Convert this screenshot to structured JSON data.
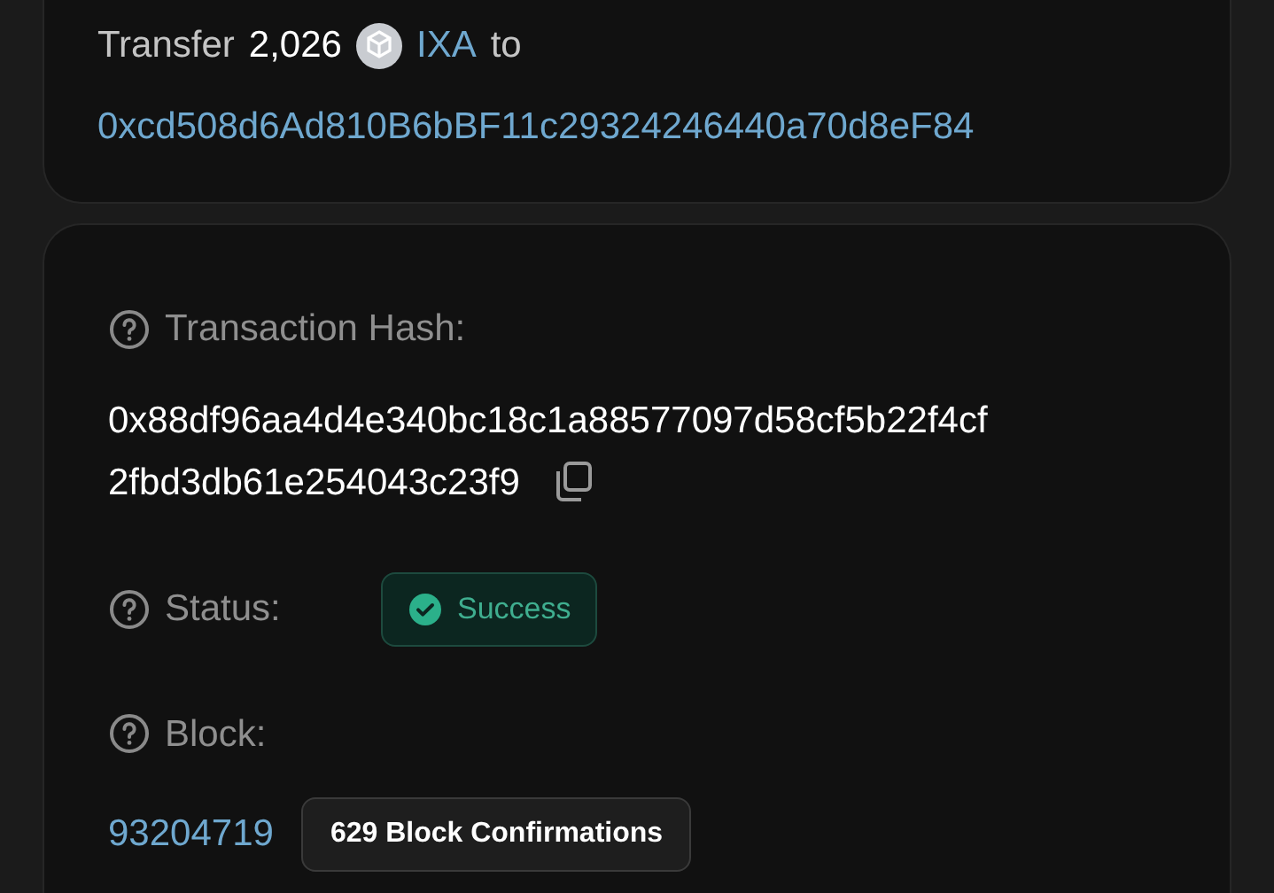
{
  "transfer": {
    "label": "Transfer",
    "amount": "2,026",
    "token": "IXA",
    "to_label": "to",
    "address": "0xcd508d6Ad810B6bBF11c29324246440a70d8eF84"
  },
  "details": {
    "hash_label": "Transaction Hash:",
    "hash": "0x88df96aa4d4e340bc18c1a88577097d58cf5b22f4cf2fbd3db61e254043c23f9",
    "status_label": "Status:",
    "status": {
      "kind": "success",
      "text": "Success"
    },
    "block_label": "Block:",
    "block": "93204719",
    "confirmations": "629 Block Confirmations"
  }
}
